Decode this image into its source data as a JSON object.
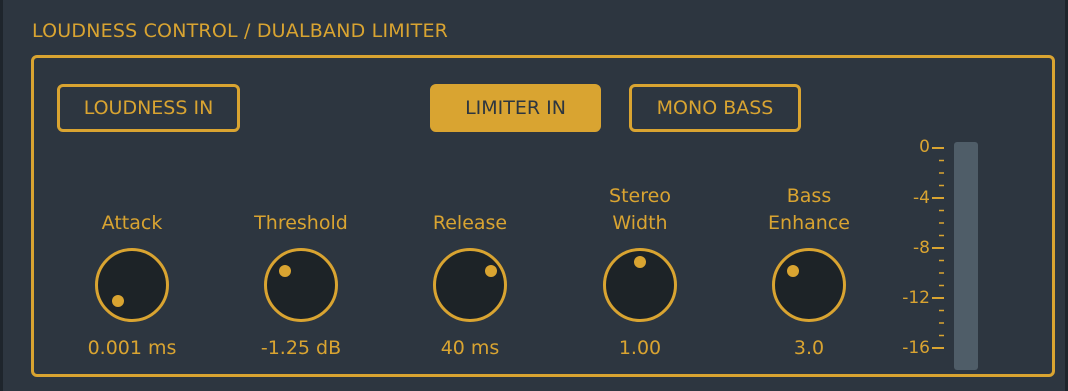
{
  "section": {
    "title": "LOUDNESS CONTROL / DUALBAND LIMITER"
  },
  "buttons": {
    "loudness_in": "LOUDNESS IN",
    "limiter_in": "LIMITER IN",
    "mono_bass": "MONO BASS"
  },
  "knobs": [
    {
      "label_line1": "",
      "label_line2": "Attack",
      "value": "0.001 ms"
    },
    {
      "label_line1": "",
      "label_line2": "Threshold",
      "value": "-1.25 dB"
    },
    {
      "label_line1": "",
      "label_line2": "Release",
      "value": "40 ms"
    },
    {
      "label_line1": "Stereo",
      "label_line2": "Width",
      "value": "1.00"
    },
    {
      "label_line1": "Bass",
      "label_line2": "Enhance",
      "value": "3.0"
    }
  ],
  "meter": {
    "scale_labels": [
      "0",
      "-4",
      "-8",
      "-12",
      "-16"
    ],
    "level": 0
  },
  "colors": {
    "accent": "#d9a431",
    "background": "#2d3640",
    "knob_fill": "#1d2327",
    "meter": "#4f5d68"
  }
}
